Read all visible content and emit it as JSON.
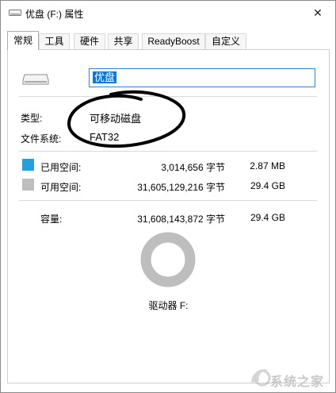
{
  "window": {
    "title": "优盘 (F:) 属性",
    "close_glyph": "✕"
  },
  "tabs": [
    {
      "label": "常规"
    },
    {
      "label": "工具"
    },
    {
      "label": "硬件"
    },
    {
      "label": "共享"
    },
    {
      "label": "ReadyBoost"
    },
    {
      "label": "自定义"
    }
  ],
  "general": {
    "drive_name": "优盘",
    "type_label": "类型:",
    "type_value": "可移动磁盘",
    "fs_label": "文件系统:",
    "fs_value": "FAT32",
    "used_label": "已用空间:",
    "used_bytes": "3,014,656 字节",
    "used_size": "2.87 MB",
    "free_label": "可用空间:",
    "free_bytes": "31,605,129,216 字节",
    "free_size": "29.4 GB",
    "capacity_label": "容量:",
    "capacity_bytes": "31,608,143,872 字节",
    "capacity_size": "29.4 GB",
    "drive_label": "驱动器 F:",
    "used_fraction": 0.0001
  },
  "colors": {
    "used": "#26a0da",
    "free": "#bebebe",
    "accent": "#0078d7"
  },
  "watermark": {
    "text": "系统之家"
  }
}
